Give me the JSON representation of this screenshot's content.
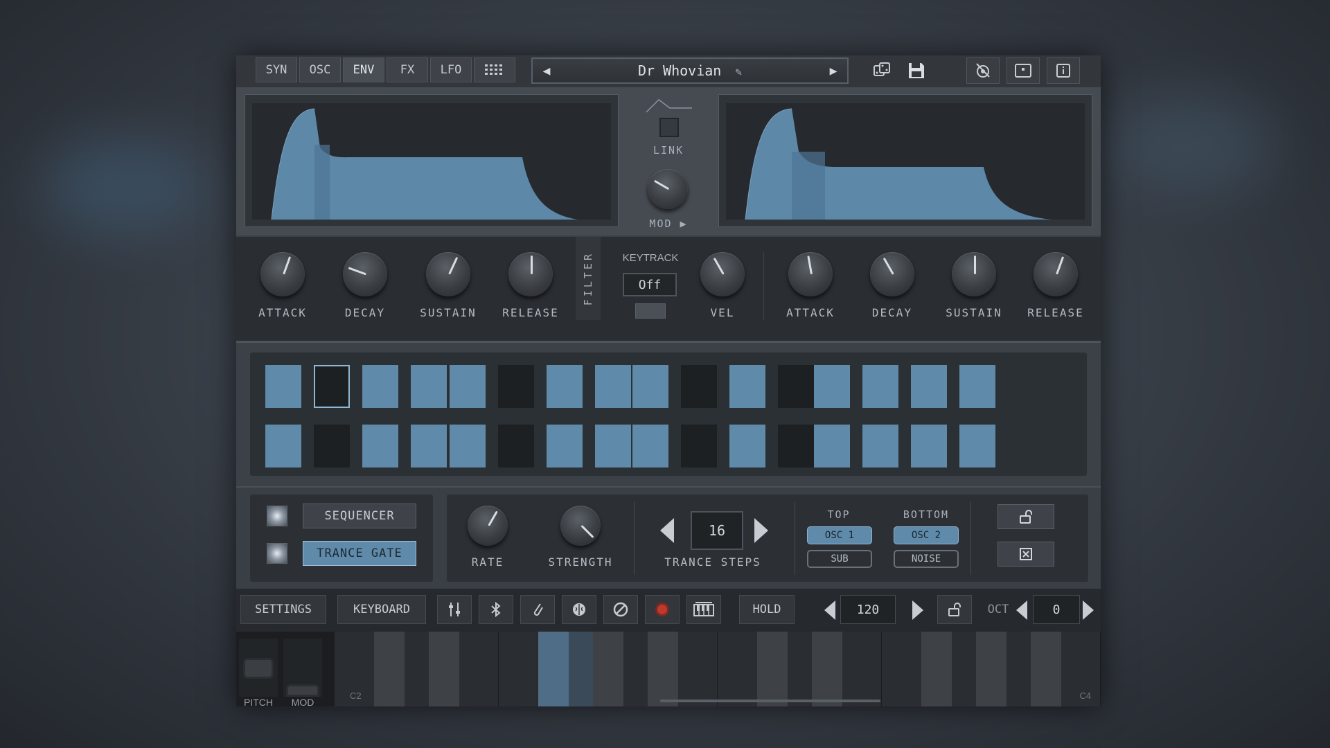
{
  "tabs": [
    {
      "label": "SYN",
      "active": false
    },
    {
      "label": "OSC",
      "active": false
    },
    {
      "label": "ENV",
      "active": true
    },
    {
      "label": "FX",
      "active": false
    },
    {
      "label": "LFO",
      "active": false
    },
    {
      "label": "⋮⋮⋮⋮",
      "active": false
    }
  ],
  "preset": {
    "prev": "◀",
    "name": "Dr Whovian",
    "edit_icon": "pencil-icon",
    "next": "▶"
  },
  "top_icons": {
    "dice": "dice-icon",
    "save": "save-icon",
    "midi": "midi-settings-icon",
    "window": "window-icon",
    "info": "info-icon"
  },
  "env_center": {
    "link_label": "LINK",
    "mod_label": "MOD ▶"
  },
  "amp_env": {
    "attack": "ATTACK",
    "decay": "DECAY",
    "sustain": "SUSTAIN",
    "release": "RELEASE"
  },
  "filter_section": {
    "filter_label": "FILTER",
    "keytrack_label": "KEYTRACK",
    "keytrack_value": "Off",
    "vel_label": "VEL"
  },
  "filter_env": {
    "attack": "ATTACK",
    "decay": "DECAY",
    "sustain": "SUSTAIN",
    "release": "RELEASE"
  },
  "steps": {
    "top": [
      1,
      0,
      1,
      1,
      1,
      0,
      1,
      1,
      1,
      0,
      1,
      0,
      1,
      1,
      1,
      1
    ],
    "bottom": [
      1,
      0,
      1,
      1,
      1,
      0,
      1,
      1,
      1,
      0,
      1,
      0,
      1,
      1,
      1,
      1
    ],
    "selected_top_index": 1,
    "on_color": "#5f8aa9",
    "off_color": "#1d2023"
  },
  "mode": {
    "sequencer": "SEQUENCER",
    "trance_gate": "TRANCE GATE",
    "active": "trance_gate"
  },
  "gate": {
    "rate": "RATE",
    "strength": "STRENGTH",
    "steps_value": "16",
    "steps_label": "TRANCE STEPS",
    "top_label": "TOP",
    "bottom_label": "BOTTOM",
    "top_osc": "OSC 1",
    "bottom_osc": "OSC 2",
    "sub": "SUB",
    "noise": "NOISE"
  },
  "toolbar": {
    "settings": "SETTINGS",
    "keyboard": "KEYBOARD",
    "hold": "HOLD",
    "bpm": "120",
    "oct_label": "OCT",
    "oct_value": "0"
  },
  "keyboard": {
    "pitch": "PITCH",
    "mod": "MOD",
    "note_low": "C2",
    "note_high": "C4"
  }
}
